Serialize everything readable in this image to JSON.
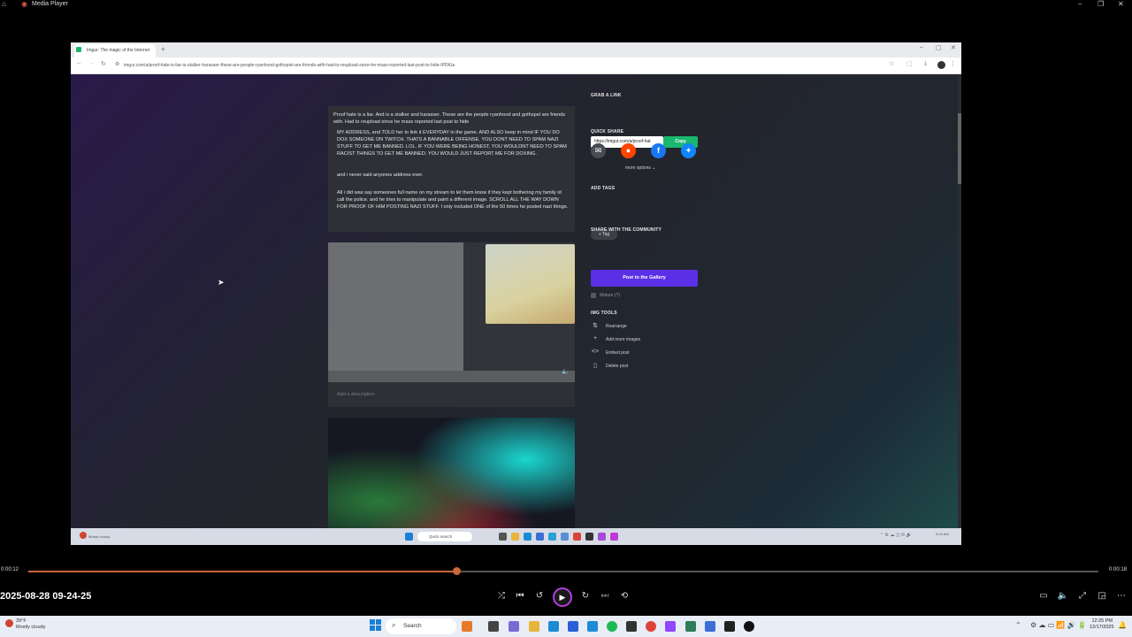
{
  "media_player": {
    "app_title": "Media Player",
    "file_title": "2025-08-28 09-24-25",
    "time_current": "0:00:12",
    "time_total": "0:00:18",
    "progress": 0.4,
    "accent_color": "#c8673a",
    "play_ring_color": "#b23fdc"
  },
  "browser": {
    "tab_title": "Imgur: The magic of the Internet",
    "url": "imgur.com/a/proof-hate-is-liar-is-stalker-harasser-these-are-people-ryanhood-gothspiel-are-friends-with-had-to-reupload-since-he-mass-reported-last-post-to-hide-IPDKIa"
  },
  "post": {
    "paragraphs": [
      "Proof hate is a liar. And is a stalker and harasser. These are the people ryanhood and gothspel are friends with. Had to reupload since he mass reported last post to hide",
      "MY ADDRESS, and TOLD her to link it EVERYDAY in the game. AND ALSO keep in mind IF YOU DO DOX SOMEONE ON TWITCH. THATS A BANNABLE OFFENSE. YOU DONT NEED TO SPAM NAZI STUFF TO GET ME BANNED. LOL. IF YOU WERE BEING HONEST, YOU WOULDNT NEED TO SPAM RACIST THINGS TO GET ME BANNED. YOU WOULD JUST REPORT ME FOR DOXING.",
      "and i never said anyones address ever.",
      "All i did was say someones full name on my stream to let them know if they kept bothering my family id call the police. and he tries to manipulate and paint a different image. SCROLL ALL THE WAY DOWN FOR PROOF OF HIM POSTING NAZI STUFF. I only included ONE of the 50 times he posted nazi things."
    ],
    "image_description_placeholder": "Add a description"
  },
  "sidebar": {
    "grab_link_heading": "GRAB A LINK",
    "link_value": "https://imgur.com/a/proof-hat",
    "copy_label": "Copy",
    "quick_share_heading": "QUICK SHARE",
    "share_buttons": [
      {
        "icon": "mail-icon",
        "glyph": "✉",
        "color": "#4a4c54"
      },
      {
        "icon": "reddit-icon",
        "glyph": "●",
        "color": "#ff4500"
      },
      {
        "icon": "facebook-icon",
        "glyph": "f",
        "color": "#1877f2"
      },
      {
        "icon": "bluesky-icon",
        "glyph": "✦",
        "color": "#1185fe"
      }
    ],
    "more_options": "more options",
    "add_tags_heading": "ADD TAGS",
    "tag_label": "+ Tag",
    "share_community_heading": "SHARE WITH THE COMMUNITY",
    "post_gallery_label": "Post to the Gallery",
    "mature_label": "Mature (?)",
    "img_tools_heading": "IMG TOOLS",
    "tools": [
      {
        "label": "Rearrange",
        "icon": "rearrange-icon",
        "glyph": "⇅"
      },
      {
        "label": "Add more images",
        "icon": "plus-icon",
        "glyph": "+"
      },
      {
        "label": "Embed post",
        "icon": "code-icon",
        "glyph": "<>"
      },
      {
        "label": "Delete post",
        "icon": "trash-icon",
        "glyph": "▯"
      }
    ]
  },
  "inner_taskbar": {
    "weather": "Mostly cloudy",
    "search": "Quick search"
  },
  "os_taskbar": {
    "weather_temp": "39°F",
    "weather_desc": "Mostly cloudy",
    "search_placeholder": "Search",
    "time": "12:25 PM",
    "date": "12/17/2025"
  }
}
